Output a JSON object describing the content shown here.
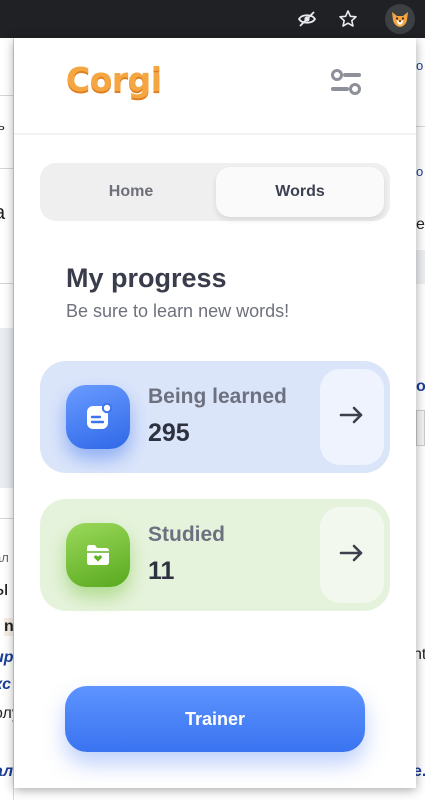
{
  "background": {
    "left_fragments": [
      "ь",
      "а",
      "ал",
      "ы",
      "n",
      "ир",
      "кс",
      "олу",
      "ал"
    ],
    "right_fragments": [
      "о",
      "о",
      "е",
      "о",
      "nt",
      "e."
    ]
  },
  "app": {
    "logo": "Corgi"
  },
  "tabs": [
    {
      "label": "Home",
      "active": false
    },
    {
      "label": "Words",
      "active": true
    }
  ],
  "progress": {
    "title": "My progress",
    "subtitle": "Be sure to learn new words!"
  },
  "cards": {
    "learning": {
      "label": "Being learned",
      "count": "295",
      "color": "#3b74ee"
    },
    "studied": {
      "label": "Studied",
      "count": "11",
      "color": "#6bbd2d"
    }
  },
  "trainer": {
    "label": "Trainer"
  },
  "icons": {
    "toolbar": [
      "eye-off-icon",
      "star-icon",
      "corgi-extension-icon"
    ],
    "header": "settings-sliders-icon",
    "cards": [
      "learning-card-icon",
      "studied-folder-icon",
      "arrow-right-icon"
    ]
  }
}
